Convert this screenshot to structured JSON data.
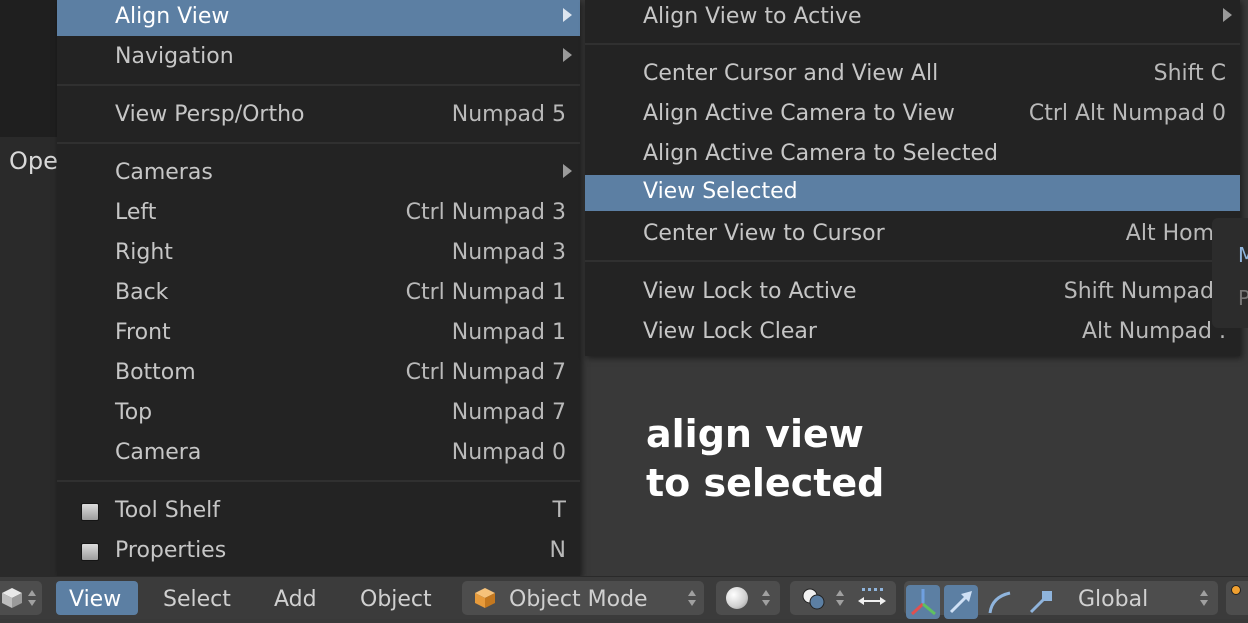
{
  "left_panel": {
    "label": "Ope"
  },
  "view_menu": {
    "items": [
      {
        "label": "Align View",
        "shortcut": ""
      },
      {
        "label": "Navigation",
        "shortcut": ""
      },
      {
        "label": "View Persp/Ortho",
        "shortcut": "Numpad 5"
      },
      {
        "label": "Cameras",
        "shortcut": ""
      },
      {
        "label": "Left",
        "shortcut": "Ctrl Numpad 3"
      },
      {
        "label": "Right",
        "shortcut": "Numpad 3"
      },
      {
        "label": "Back",
        "shortcut": "Ctrl Numpad 1"
      },
      {
        "label": "Front",
        "shortcut": "Numpad 1"
      },
      {
        "label": "Bottom",
        "shortcut": "Ctrl Numpad 7"
      },
      {
        "label": "Top",
        "shortcut": "Numpad 7"
      },
      {
        "label": "Camera",
        "shortcut": "Numpad 0"
      },
      {
        "label": "Tool Shelf",
        "shortcut": "T"
      },
      {
        "label": "Properties",
        "shortcut": "N"
      }
    ]
  },
  "align_view_submenu": {
    "items": [
      {
        "label": "Align View to Active",
        "shortcut": ""
      },
      {
        "label": "Center Cursor and View All",
        "shortcut": "Shift C"
      },
      {
        "label": "Align Active Camera to View",
        "shortcut": "Ctrl Alt Numpad 0"
      },
      {
        "label": "Align Active Camera to Selected",
        "shortcut": ""
      },
      {
        "label": "View Selected",
        "shortcut": ""
      },
      {
        "label": "Center View to Cursor",
        "shortcut": "Alt Hom"
      },
      {
        "label": "View Lock to Active",
        "shortcut": "Shift Numpad"
      },
      {
        "label": "View Lock Clear",
        "shortcut": "Alt Numpad ."
      }
    ]
  },
  "annotation": {
    "line1": "align view",
    "line2": "to selected"
  },
  "edge_panel": {
    "m": "M",
    "p": "P"
  },
  "header": {
    "view": "View",
    "select": "Select",
    "add": "Add",
    "object": "Object",
    "mode": "Object Mode",
    "orientation": "Global"
  },
  "colors": {
    "highlight": "#5c7fa3",
    "menu_bg": "#232323",
    "header_bg": "#3b3b3b"
  },
  "icons": [
    "cube-icon",
    "sphere-shading-icon",
    "pivot-icon",
    "snap-icon",
    "manipulator-axes-icon",
    "translate-arrow-icon",
    "rotate-icon",
    "scale-icon"
  ]
}
